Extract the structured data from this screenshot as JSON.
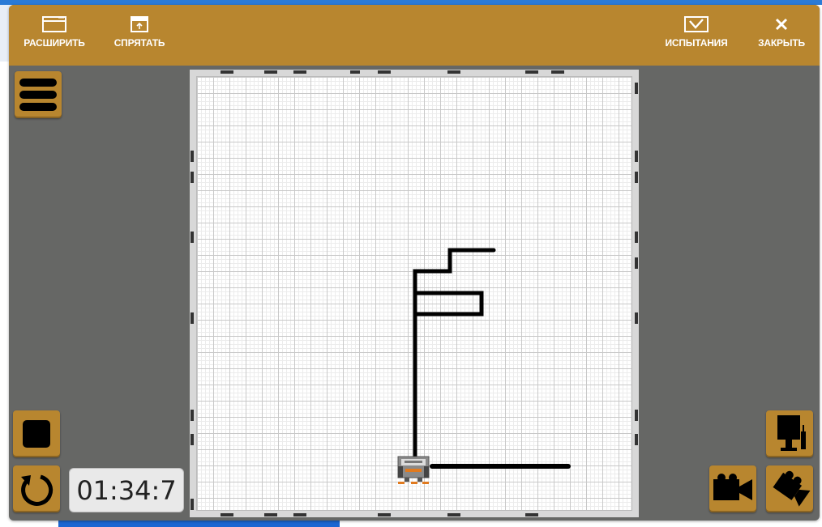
{
  "toolbar": {
    "expand_label": "РАСШИРИТЬ",
    "hide_label": "СПРЯТАТЬ",
    "tests_label": "ИСПЫТАНИЯ",
    "close_label": "ЗАКРЫТЬ"
  },
  "controls": {
    "timer": "01:34:7"
  },
  "colors": {
    "toolbar": "#b8862f",
    "window_bg": "#666765",
    "line": "#000000"
  },
  "icons": {
    "expand": "window-expand-icon",
    "hide": "window-hide-icon",
    "tests": "checkbox-icon",
    "close": "close-icon",
    "menu": "hamburger-menu-icon",
    "stop": "stop-icon",
    "reset": "restart-icon",
    "camera_top": "top-camera-icon",
    "camera_follow": "video-camera-icon",
    "camera_free": "free-camera-icon",
    "robot": "robot-icon"
  }
}
